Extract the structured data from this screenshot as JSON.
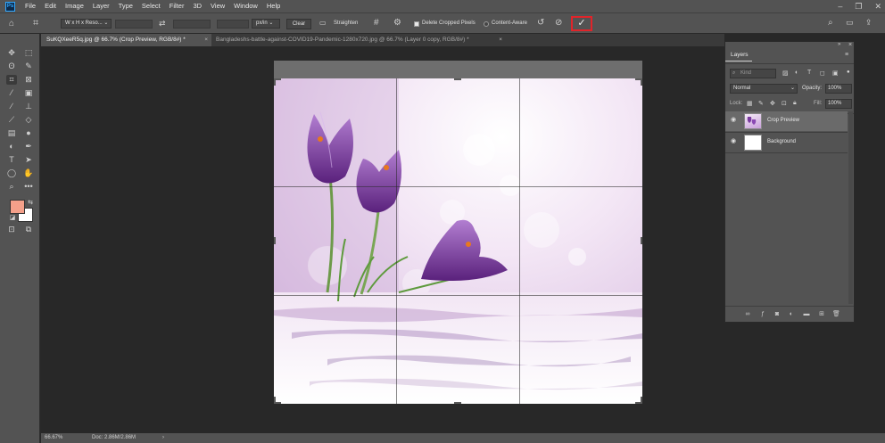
{
  "app": {
    "logo": "Ps"
  },
  "menu": [
    "File",
    "Edit",
    "Image",
    "Layer",
    "Type",
    "Select",
    "Filter",
    "3D",
    "View",
    "Window",
    "Help"
  ],
  "options": {
    "ratio_preset": "W x H x Reso...",
    "unit": "px/in",
    "clear_label": "Clear",
    "straighten_label": "Straighten",
    "delete_cropped_label": "Delete Cropped Pixels",
    "delete_cropped_checked": true,
    "content_aware_label": "Content-Aware",
    "content_aware_checked": false
  },
  "tabs": [
    {
      "label": "SuKQXeeR5q.jpg @ 66.7% (Crop Preview, RGB/8#) *",
      "active": true
    },
    {
      "label": "Bangladeshs-battle-against-COVID19-Pandemic-1280x720.jpg @ 66.7% (Layer 0 copy, RGB/8#) *",
      "active": false
    }
  ],
  "status": {
    "zoom": "66.67%",
    "doc": "Doc: 2.86M/2.86M",
    "arrow": "›"
  },
  "colors": {
    "foreground": "#f4a08a",
    "background": "#ffffff",
    "commit_outline": "#e0242a"
  },
  "layers_panel": {
    "tab_label": "Layers",
    "search_placeholder": "Kind",
    "blend_mode": "Normal",
    "opacity_label": "Opacity:",
    "opacity_value": "100%",
    "lock_label": "Lock:",
    "fill_label": "Fill:",
    "fill_value": "100%",
    "layers": [
      {
        "name": "Crop Preview",
        "selected": true
      },
      {
        "name": "Background",
        "selected": false
      }
    ]
  }
}
